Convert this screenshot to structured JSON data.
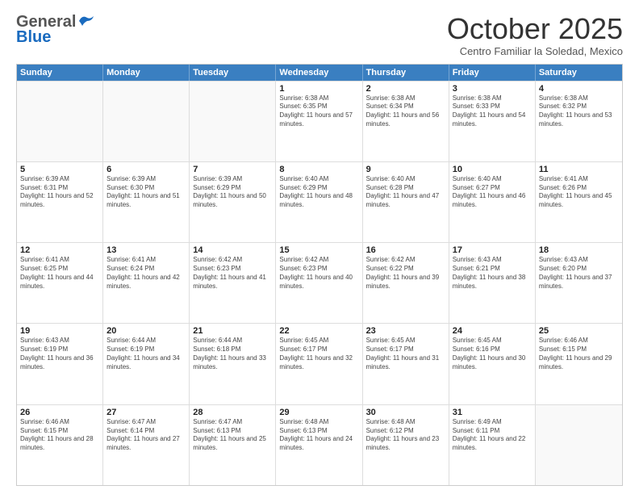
{
  "header": {
    "logo_general": "General",
    "logo_blue": "Blue",
    "month_title": "October 2025",
    "subtitle": "Centro Familiar la Soledad, Mexico"
  },
  "weekdays": [
    "Sunday",
    "Monday",
    "Tuesday",
    "Wednesday",
    "Thursday",
    "Friday",
    "Saturday"
  ],
  "rows": [
    [
      {
        "day": "",
        "info": ""
      },
      {
        "day": "",
        "info": ""
      },
      {
        "day": "",
        "info": ""
      },
      {
        "day": "1",
        "info": "Sunrise: 6:38 AM\nSunset: 6:35 PM\nDaylight: 11 hours and 57 minutes."
      },
      {
        "day": "2",
        "info": "Sunrise: 6:38 AM\nSunset: 6:34 PM\nDaylight: 11 hours and 56 minutes."
      },
      {
        "day": "3",
        "info": "Sunrise: 6:38 AM\nSunset: 6:33 PM\nDaylight: 11 hours and 54 minutes."
      },
      {
        "day": "4",
        "info": "Sunrise: 6:38 AM\nSunset: 6:32 PM\nDaylight: 11 hours and 53 minutes."
      }
    ],
    [
      {
        "day": "5",
        "info": "Sunrise: 6:39 AM\nSunset: 6:31 PM\nDaylight: 11 hours and 52 minutes."
      },
      {
        "day": "6",
        "info": "Sunrise: 6:39 AM\nSunset: 6:30 PM\nDaylight: 11 hours and 51 minutes."
      },
      {
        "day": "7",
        "info": "Sunrise: 6:39 AM\nSunset: 6:29 PM\nDaylight: 11 hours and 50 minutes."
      },
      {
        "day": "8",
        "info": "Sunrise: 6:40 AM\nSunset: 6:29 PM\nDaylight: 11 hours and 48 minutes."
      },
      {
        "day": "9",
        "info": "Sunrise: 6:40 AM\nSunset: 6:28 PM\nDaylight: 11 hours and 47 minutes."
      },
      {
        "day": "10",
        "info": "Sunrise: 6:40 AM\nSunset: 6:27 PM\nDaylight: 11 hours and 46 minutes."
      },
      {
        "day": "11",
        "info": "Sunrise: 6:41 AM\nSunset: 6:26 PM\nDaylight: 11 hours and 45 minutes."
      }
    ],
    [
      {
        "day": "12",
        "info": "Sunrise: 6:41 AM\nSunset: 6:25 PM\nDaylight: 11 hours and 44 minutes."
      },
      {
        "day": "13",
        "info": "Sunrise: 6:41 AM\nSunset: 6:24 PM\nDaylight: 11 hours and 42 minutes."
      },
      {
        "day": "14",
        "info": "Sunrise: 6:42 AM\nSunset: 6:23 PM\nDaylight: 11 hours and 41 minutes."
      },
      {
        "day": "15",
        "info": "Sunrise: 6:42 AM\nSunset: 6:23 PM\nDaylight: 11 hours and 40 minutes."
      },
      {
        "day": "16",
        "info": "Sunrise: 6:42 AM\nSunset: 6:22 PM\nDaylight: 11 hours and 39 minutes."
      },
      {
        "day": "17",
        "info": "Sunrise: 6:43 AM\nSunset: 6:21 PM\nDaylight: 11 hours and 38 minutes."
      },
      {
        "day": "18",
        "info": "Sunrise: 6:43 AM\nSunset: 6:20 PM\nDaylight: 11 hours and 37 minutes."
      }
    ],
    [
      {
        "day": "19",
        "info": "Sunrise: 6:43 AM\nSunset: 6:19 PM\nDaylight: 11 hours and 36 minutes."
      },
      {
        "day": "20",
        "info": "Sunrise: 6:44 AM\nSunset: 6:19 PM\nDaylight: 11 hours and 34 minutes."
      },
      {
        "day": "21",
        "info": "Sunrise: 6:44 AM\nSunset: 6:18 PM\nDaylight: 11 hours and 33 minutes."
      },
      {
        "day": "22",
        "info": "Sunrise: 6:45 AM\nSunset: 6:17 PM\nDaylight: 11 hours and 32 minutes."
      },
      {
        "day": "23",
        "info": "Sunrise: 6:45 AM\nSunset: 6:17 PM\nDaylight: 11 hours and 31 minutes."
      },
      {
        "day": "24",
        "info": "Sunrise: 6:45 AM\nSunset: 6:16 PM\nDaylight: 11 hours and 30 minutes."
      },
      {
        "day": "25",
        "info": "Sunrise: 6:46 AM\nSunset: 6:15 PM\nDaylight: 11 hours and 29 minutes."
      }
    ],
    [
      {
        "day": "26",
        "info": "Sunrise: 6:46 AM\nSunset: 6:15 PM\nDaylight: 11 hours and 28 minutes."
      },
      {
        "day": "27",
        "info": "Sunrise: 6:47 AM\nSunset: 6:14 PM\nDaylight: 11 hours and 27 minutes."
      },
      {
        "day": "28",
        "info": "Sunrise: 6:47 AM\nSunset: 6:13 PM\nDaylight: 11 hours and 25 minutes."
      },
      {
        "day": "29",
        "info": "Sunrise: 6:48 AM\nSunset: 6:13 PM\nDaylight: 11 hours and 24 minutes."
      },
      {
        "day": "30",
        "info": "Sunrise: 6:48 AM\nSunset: 6:12 PM\nDaylight: 11 hours and 23 minutes."
      },
      {
        "day": "31",
        "info": "Sunrise: 6:49 AM\nSunset: 6:11 PM\nDaylight: 11 hours and 22 minutes."
      },
      {
        "day": "",
        "info": ""
      }
    ]
  ]
}
